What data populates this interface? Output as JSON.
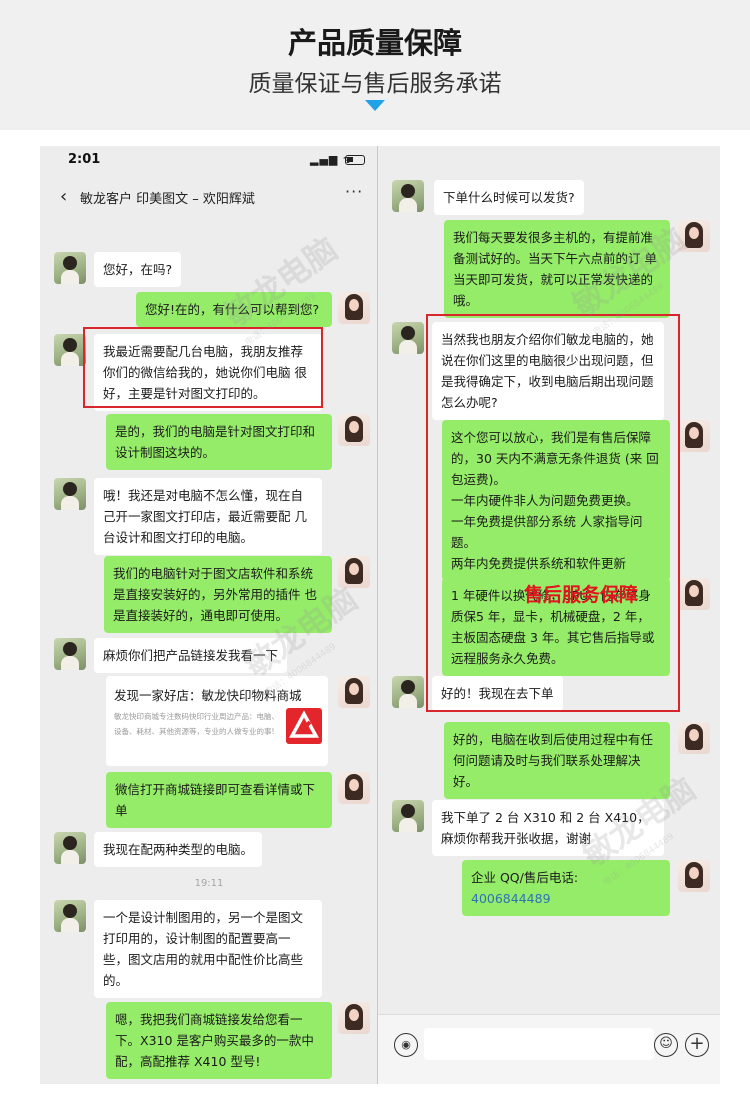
{
  "banner": {
    "title": "产品质量保障",
    "subtitle": "质量保证与售后服务承诺"
  },
  "status_bar": {
    "time": "2:01",
    "signal": "▂▄▆ ᯤ"
  },
  "chat_header": {
    "back": "‹",
    "title": "敏龙客户  印美图文 – 欢阳辉斌",
    "more": "···"
  },
  "left_chat": {
    "messages": [
      {
        "from": "customer",
        "text": "您好，在吗?"
      },
      {
        "from": "agent",
        "text": "您好!在的，有什么可以帮到您?"
      },
      {
        "from": "customer",
        "text": "我最近需要配几台电脑，我朋友推荐你们的微信给我的，她说你们电脑 很好，主要是针对图文打印的。"
      },
      {
        "from": "agent",
        "text": "是的，我们的电脑是针对图文打印和设计制图这块的。"
      },
      {
        "from": "customer",
        "text": "哦！我还是对电脑不怎么懂，现在自己开一家图文打印店，最近需要配 几台设计和图文打印的电脑。"
      },
      {
        "from": "agent",
        "text": "我们的电脑针对于图文店软件和系统是直接安装好的，另外常用的插件 也是直接装好的，通电即可使用。"
      },
      {
        "from": "customer",
        "text": "麻烦你们把产品链接发我看一下"
      },
      {
        "from": "agent",
        "text": "微信打开商城链接即可查看详情或下单"
      },
      {
        "from": "customer",
        "text": "我现在配两种类型的电脑。"
      },
      {
        "from": "customer",
        "text": "一个是设计制图用的，另一个是图文打印用的，设计制图的配置要高一些，图文店用的就用中配性价比高些的。"
      },
      {
        "from": "agent",
        "text": "嗯，我把我们商城链接发给您看一下。X310 是客户购买最多的一款中配，高配推荐 X410 型号!"
      }
    ],
    "link_card": {
      "title": "发现一家好店：敏龙快印物料商城",
      "desc": "敏龙快印商城专注数码快印行业周边产品：电脑、设备、耗材、其他资源等，专业的人做专业的事!"
    },
    "timestamp": "19:11"
  },
  "right_chat": {
    "messages": [
      {
        "from": "customer",
        "text": "下单什么时候可以发货?"
      },
      {
        "from": "agent",
        "text": "我们每天要发很多主机的，有提前准备测试好的。当天下午六点前的订 单当天即可发货，就可以正常发快递的哦。"
      },
      {
        "from": "customer",
        "text": "当然我也朋友介绍你们敏龙电脑的，她说在你们这里的电脑很少出现问题，但是我得确定下，收到电脑后期出现问题怎么办呢?"
      },
      {
        "from": "agent",
        "text": "这个您可以放心，我们是有售后保障的，30 天内不满意无条件退货 (来 回包运费)。\n一年内硬件非人为问题免费更换。\n一年免费提供部分系统 人家指导问题。\n两年内免费提供系统和软件更新"
      },
      {
        "from": "agent",
        "text": "1 年硬件以换代修，CPU、内存终身质保5 年，显卡，机械硬盘，2 年，主板固态硬盘 3 年。其它售后指导或远程服务永久免费。"
      },
      {
        "from": "customer",
        "text": "好的！我现在去下单"
      },
      {
        "from": "agent",
        "text": "好的，电脑在收到后使用过程中有任何问题请及时与我们联系处理解决好。"
      },
      {
        "from": "customer",
        "text": "我下单了 2 台 X310 和 2 台 X410，麻烦你帮我开张收据，谢谢"
      },
      {
        "from": "agent",
        "text_label": "企业 QQ/售后电话:",
        "phone": "4006844489"
      }
    ],
    "highlight_label": "售后服务保障"
  },
  "input_bar": {
    "voice_icon": "◉",
    "emoji_icon": "☺",
    "plus_icon": "+"
  },
  "watermark": {
    "brand": "敏龙电脑",
    "phone": "电话：4006844489"
  },
  "colors": {
    "outgoing_bubble": "#95ec69",
    "incoming_bubble": "#ffffff",
    "highlight_red": "#d9262c",
    "phone_link": "#2e72b8",
    "arrow": "#1fa2e6"
  }
}
